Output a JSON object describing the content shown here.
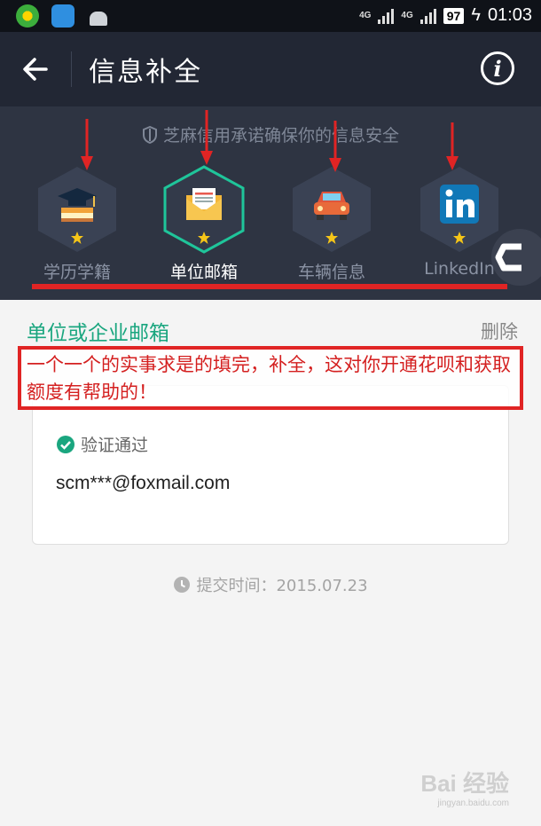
{
  "status_bar": {
    "icons": [
      "app-icon-green",
      "cloud-icon",
      "android-icon"
    ],
    "network": [
      "4G",
      "4G"
    ],
    "battery": "97",
    "time": "01:03"
  },
  "header": {
    "title": "信息补全",
    "back_icon": "arrow-left-icon",
    "info_icon": "info-icon"
  },
  "notice": "芝麻信用承诺确保你的信息安全",
  "categories": [
    {
      "label": "学历学籍",
      "icon": "graduation-cap-icon",
      "active": false
    },
    {
      "label": "单位邮箱",
      "icon": "envelope-icon",
      "active": true
    },
    {
      "label": "车辆信息",
      "icon": "car-icon",
      "active": false
    },
    {
      "label": "LinkedIn",
      "icon": "linkedin-icon",
      "active": false
    }
  ],
  "section": {
    "title": "单位或企业邮箱",
    "delete_label": "删除",
    "verified_label": "验证通过",
    "email": "scm***@foxmail.com",
    "submit_time": "提交时间：2015.07.23"
  },
  "annotation": "一个一个的实事求是的填完，补全，这对你开通花呗和获取额度有帮助的！",
  "watermark": {
    "brand": "Bai 经验",
    "url": "jingyan.baidu.com"
  },
  "colors": {
    "accent_green": "#1aa67f",
    "annotation_red": "#e02424",
    "header_bg": "#222734",
    "band_bg": "#2e3442"
  }
}
